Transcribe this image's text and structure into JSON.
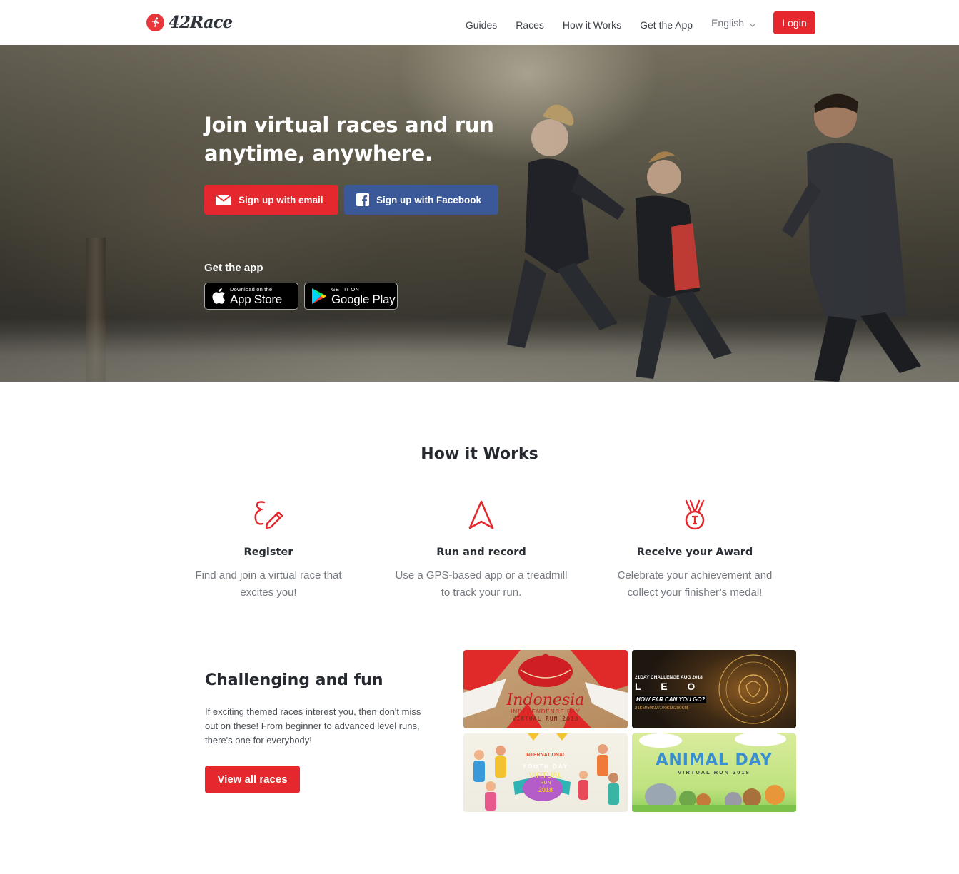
{
  "brand": {
    "name": "42Race",
    "accent": "#e4282d",
    "facebook": "#3b5998"
  },
  "nav": {
    "items": [
      "Guides",
      "Races",
      "How it Works",
      "Get the App"
    ],
    "language": "English",
    "login": "Login"
  },
  "hero": {
    "title_line1": "Join virtual races and run",
    "title_line2": "anytime, anywhere.",
    "email_button": "Sign up with email",
    "facebook_button": "Sign up with Facebook",
    "get_app": "Get the app",
    "app_store": {
      "small": "Download on the",
      "big": "App Store"
    },
    "google_play": {
      "small": "GET IT ON",
      "big": "Google Play"
    }
  },
  "how": {
    "title": "How it Works",
    "steps": [
      {
        "icon": "pen-icon",
        "title": "Register",
        "line1": "Find and join a virtual race that",
        "line2": "excites you!"
      },
      {
        "icon": "navigation-arrow-icon",
        "title": "Run and record",
        "line1": "Use a GPS-based app or a treadmill",
        "line2": "to track your run."
      },
      {
        "icon": "medal-icon",
        "title": "Receive your Award",
        "line1": "Celebrate your achievement and",
        "line2": "collect your finisher’s medal!"
      }
    ]
  },
  "challenge": {
    "title": "Challenging and fun",
    "line1": "If exciting themed races interest you, then don't miss",
    "line2": "out on these! From beginner to advanced level runs,",
    "line3": "there's one for everybody!",
    "button": "View all races",
    "cards": {
      "indonesia": {
        "title": "Indonesia",
        "sub1": "INDEPENDENCE DAY",
        "sub2": "VIRTUAL RUN 2018"
      },
      "leo": {
        "top": "21DAY CHALLENGE AUG 2018",
        "letters": "L  E  O",
        "question": "HOW FAR CAN YOU GO?",
        "distances": "21KM/50KM/100KM/200KM"
      },
      "youth": {
        "l1": "INTERNATIONAL",
        "l2": "YOUTH DAY",
        "l3": "VIRTUAL",
        "l4": "RUN",
        "l5": "2018"
      },
      "animal": {
        "title": "ANIMAL DAY",
        "sub": "VIRTUAL RUN 2018"
      }
    }
  }
}
